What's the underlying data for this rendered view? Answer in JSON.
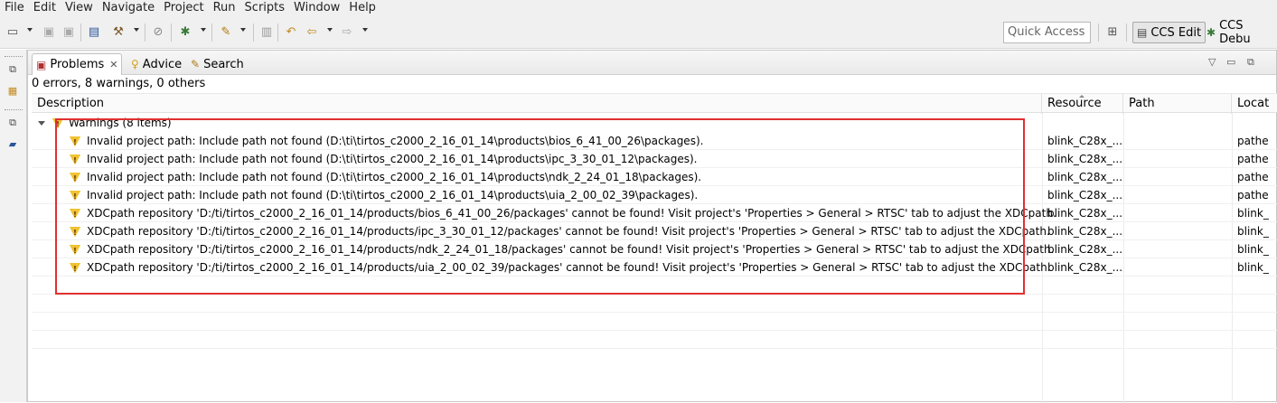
{
  "menu": [
    "File",
    "Edit",
    "View",
    "Navigate",
    "Project",
    "Run",
    "Scripts",
    "Window",
    "Help"
  ],
  "toolbar": {
    "quick_access_placeholder": "Quick Access",
    "perspectives": [
      {
        "label": "CCS Edit",
        "active": true
      },
      {
        "label": "CCS Debu",
        "active": false
      }
    ]
  },
  "tabs": [
    {
      "label": "Problems",
      "icon": "problems-icon",
      "active": true
    },
    {
      "label": "Advice",
      "icon": "lightbulb-icon",
      "active": false
    },
    {
      "label": "Search",
      "icon": "search-icon",
      "active": false
    }
  ],
  "summary": "0 errors, 8 warnings, 0 others",
  "columns": [
    "Description",
    "Resource",
    "Path",
    "Locat"
  ],
  "group": {
    "label": "Warnings (8 items)",
    "icon": "warning-icon"
  },
  "rows": [
    {
      "description": "Invalid project path: Include path not found (D:\\ti\\tirtos_c2000_2_16_01_14\\products\\bios_6_41_00_26\\packages).",
      "resource": "blink_C28x_...",
      "path": "",
      "location": "pathe"
    },
    {
      "description": "Invalid project path: Include path not found (D:\\ti\\tirtos_c2000_2_16_01_14\\products\\ipc_3_30_01_12\\packages).",
      "resource": "blink_C28x_...",
      "path": "",
      "location": "pathe"
    },
    {
      "description": "Invalid project path: Include path not found (D:\\ti\\tirtos_c2000_2_16_01_14\\products\\ndk_2_24_01_18\\packages).",
      "resource": "blink_C28x_...",
      "path": "",
      "location": "pathe"
    },
    {
      "description": "Invalid project path: Include path not found (D:\\ti\\tirtos_c2000_2_16_01_14\\products\\uia_2_00_02_39\\packages).",
      "resource": "blink_C28x_...",
      "path": "",
      "location": "pathe"
    },
    {
      "description": "XDCpath repository 'D:/ti/tirtos_c2000_2_16_01_14/products/bios_6_41_00_26/packages' cannot be found! Visit project's 'Properties > General > RTSC' tab to adjust the XDCpath.",
      "resource": "blink_C28x_...",
      "path": "",
      "location": "blink_"
    },
    {
      "description": "XDCpath repository 'D:/ti/tirtos_c2000_2_16_01_14/products/ipc_3_30_01_12/packages' cannot be found! Visit project's 'Properties > General > RTSC' tab to adjust the XDCpath.",
      "resource": "blink_C28x_...",
      "path": "",
      "location": "blink_"
    },
    {
      "description": "XDCpath repository 'D:/ti/tirtos_c2000_2_16_01_14/products/ndk_2_24_01_18/packages' cannot be found! Visit project's 'Properties > General > RTSC' tab to adjust the XDCpath.",
      "resource": "blink_C28x_...",
      "path": "",
      "location": "blink_"
    },
    {
      "description": "XDCpath repository 'D:/ti/tirtos_c2000_2_16_01_14/products/uia_2_00_02_39/packages' cannot be found! Visit project's 'Properties > General > RTSC' tab to adjust the XDCpath.",
      "resource": "blink_C28x_...",
      "path": "",
      "location": "blink_"
    }
  ],
  "colors": {
    "highlight": "#e03030",
    "warning": "#f1c232"
  }
}
